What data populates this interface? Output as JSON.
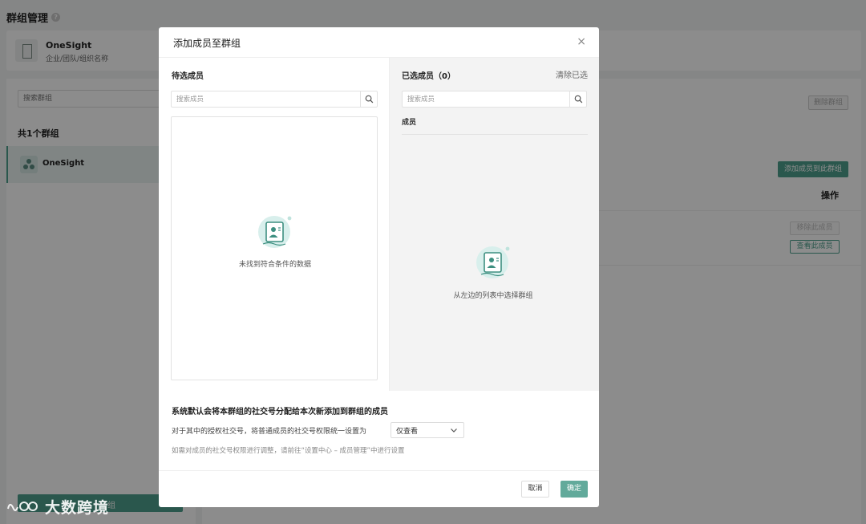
{
  "page": {
    "title": "群组管理",
    "org": {
      "name": "OneSight",
      "subtitle": "企业/团队/组织名称"
    },
    "sidebar": {
      "search_placeholder": "搜索群组",
      "group_count": "共1个群组",
      "groups": [
        {
          "label": "OneSight"
        }
      ],
      "create_button": "组"
    },
    "detail": {
      "delete_button": "删除群组",
      "add_members_button": "添加成员到此群组",
      "ops_header": "操作",
      "remove_button": "移除此成员",
      "view_button": "查看此成员"
    }
  },
  "modal": {
    "title": "添加成员至群组",
    "close": "×",
    "pending": {
      "title": "待选成员",
      "search_placeholder": "搜索成员",
      "empty_text": "未找到符合条件的数据"
    },
    "selected": {
      "title": "已选成员（0）",
      "clear": "清除已选",
      "search_placeholder": "搜索成员",
      "column": "成员",
      "empty_text": "从左边的列表中选择群组"
    },
    "settings": {
      "title": "系统默认会将本群组的社交号分配给本次新添加到群组的成员",
      "row_label": "对于其中的授权社交号，将普通成员的社交号权限统一设置为",
      "permission_value": "仅查看",
      "hint": "如需对成员的社交号权限进行调整，请前往“设置中心 – 成员管理”中进行设置"
    },
    "footer": {
      "cancel": "取消",
      "ok": "确定"
    }
  },
  "watermark": {
    "text": "大数跨境"
  },
  "colors": {
    "accent": "#4e9e8c",
    "ok_button": "#62aa9b",
    "overlay": "rgba(0,0,0,0.45)"
  },
  "icons": {
    "search": "search-icon",
    "close": "close-icon",
    "chevron": "chevron-down-icon",
    "empty": "empty-contact-card-icon"
  }
}
